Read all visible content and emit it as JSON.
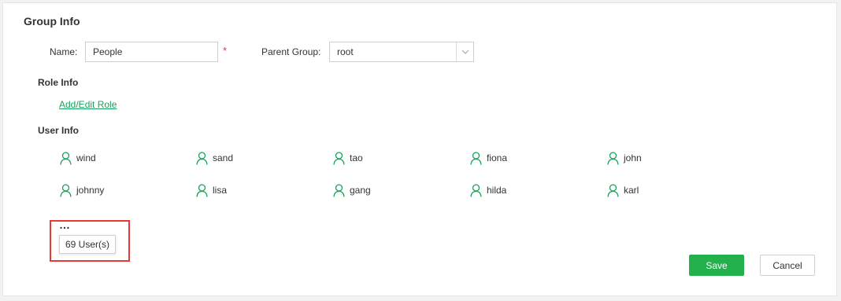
{
  "group_info": {
    "title": "Group Info",
    "name_label": "Name:",
    "name_value": "People",
    "required_marker": "*",
    "parent_label": "Parent Group:",
    "parent_value": "root"
  },
  "role_info": {
    "title": "Role Info",
    "link_label": "Add/Edit Role"
  },
  "user_info": {
    "title": "User Info",
    "users": [
      "wind",
      "sand",
      "tao",
      "fiona",
      "john",
      "johnny",
      "lisa",
      "gang",
      "hilda",
      "karl"
    ],
    "more_indicator": "…",
    "tooltip": "69 User(s)"
  },
  "actions": {
    "save_label": "Save",
    "cancel_label": "Cancel"
  },
  "colors": {
    "accent": "#22b14c",
    "link": "#1aa05a",
    "highlight": "#e53935"
  }
}
